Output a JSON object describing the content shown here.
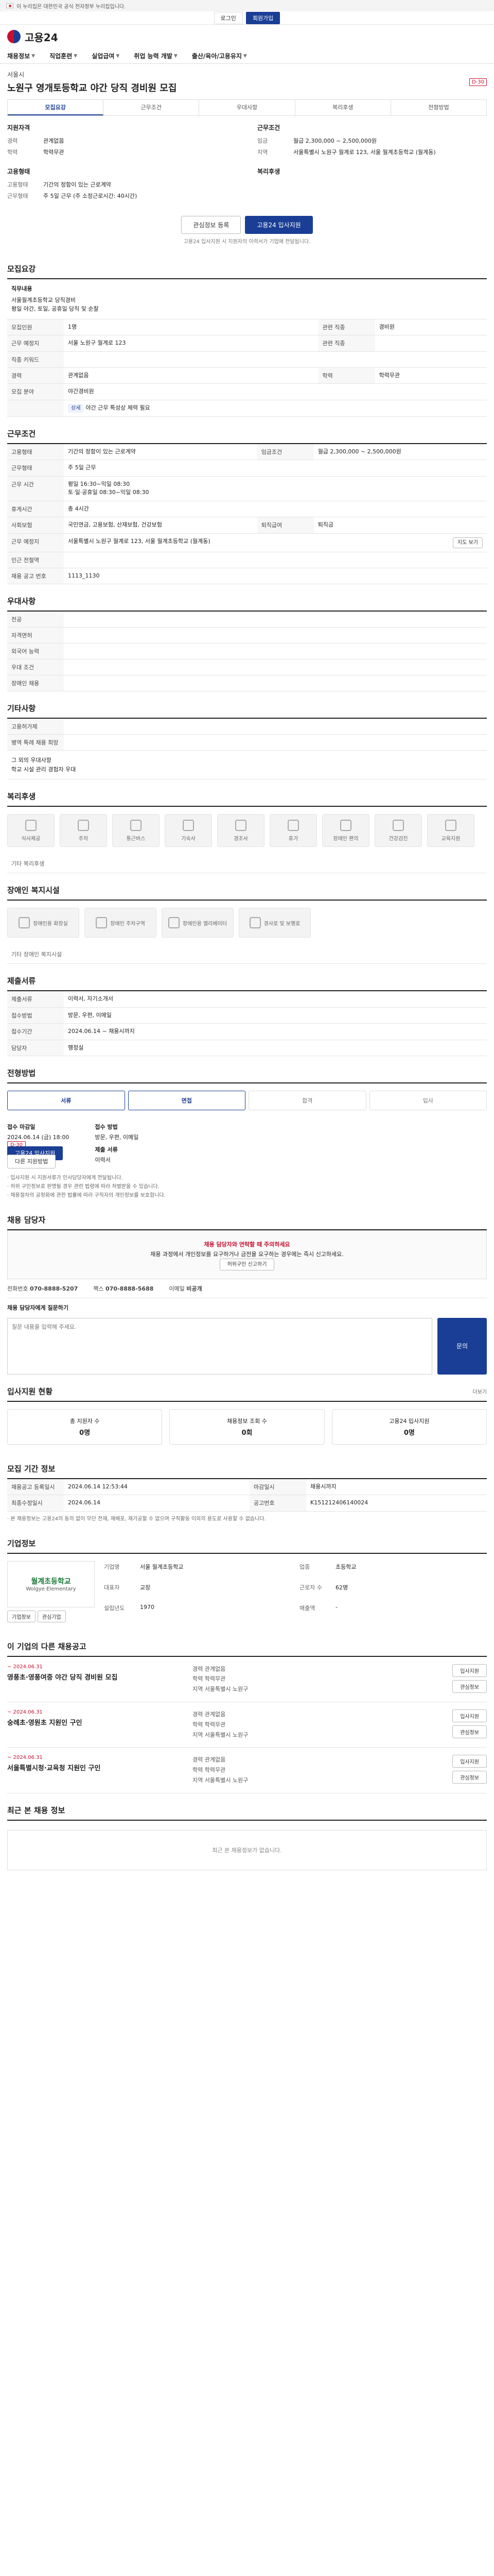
{
  "banner": {
    "text": "이 누리집은 대한민국 공식 전자정부 누리집입니다."
  },
  "login": {
    "login_label": "로그인",
    "join_label": "회원가입"
  },
  "brand": {
    "name": "고용24"
  },
  "gnb": [
    "채용정보",
    "직업훈련",
    "실업급여",
    "취업 능력 개발",
    "출산/육아/고용유지"
  ],
  "job": {
    "company": "서울시",
    "title": "노원구 영개토등학교 야간 당직 경비원 모집",
    "dday": "D-30",
    "tabs": [
      "모집요강",
      "근무조건",
      "우대사항",
      "복리후생",
      "전형방법"
    ]
  },
  "summary": {
    "left_head": "지원자격",
    "left": [
      {
        "k": "경력",
        "v": "관계없음"
      },
      {
        "k": "학력",
        "v": "학력무관"
      }
    ],
    "right_head": "근무조건",
    "right": [
      {
        "k": "임금",
        "v": "월급 2,300,000 ~ 2,500,000원"
      },
      {
        "k": "지역",
        "v": "서울특별시 노원구 월계로 123, 서울 월계초등학교 (월계동)"
      }
    ],
    "left2_head": "고용형태",
    "left2": [
      {
        "k": "고용형태",
        "v": "기간의 정함이 있는 근로계약"
      },
      {
        "k": "근무형태",
        "v": "주 5일 근무 (주 소정근로시간: 40시간)"
      }
    ],
    "right2_head": "복리후생",
    "right2": []
  },
  "actions": {
    "scrap": "관심정보 등록",
    "apply": "고용24 입사지원"
  },
  "notice": "고용24 입사지원 시 지원자의 이력서가 기업에 전달됩니다.",
  "recruit": {
    "title": "모집요강",
    "job_title_label": "직무내용",
    "job_desc": "서울월계초등학교 당직경비\n평일 야간, 토일, 공휴일 당직 및 순찰",
    "rows": [
      {
        "k": "모집인원",
        "v": "1명",
        "k2": "관련 직종",
        "v2": "경비원"
      },
      {
        "k": "근무 예정지",
        "v": "서울 노원구 월계로 123",
        "k2": "관련 직종",
        "v2": ""
      },
      {
        "k": "직종 키워드",
        "v": "",
        "k2": "",
        "v2": ""
      },
      {
        "k": "경력",
        "v": "관계없음",
        "k2": "학력",
        "v2": "학력무관"
      },
      {
        "k": "모집 분야",
        "v": "야간경비원",
        "k2": "",
        "v2": ""
      }
    ],
    "badge": "상세",
    "badge_note": "야간 근무 특성상 체력 필요"
  },
  "conditions": {
    "title": "근무조건",
    "rows": [
      {
        "k": "고용형태",
        "v": "기간의 정함이 있는 근로계약",
        "k2": "임금조건",
        "v2": "월급 2,300,000 ~ 2,500,000원"
      },
      {
        "k": "근무형태",
        "v": "주 5일 근무",
        "k2": "",
        "v2": ""
      },
      {
        "k": "근무 시간",
        "v": "평일 16:30~익일 08:30\n토·일·공휴일 08:30~익일 08:30",
        "k2": "",
        "v2": ""
      },
      {
        "k": "휴게시간",
        "v": "총 4시간",
        "k2": "",
        "v2": ""
      },
      {
        "k": "사회보험",
        "v": "국민연금, 고용보험, 산재보험, 건강보험",
        "k2": "퇴직급여",
        "v2": "퇴직금"
      },
      {
        "k": "근무 예정지",
        "v": "서울특별시 노원구 월계로 123, 서울 월계초등학교 (월계동)",
        "k2": "",
        "v2": ""
      },
      {
        "k": "인근 전철역",
        "v": "",
        "k2": "",
        "v2": ""
      },
      {
        "k": "채용 공고 번호",
        "v": "1113_1130",
        "k2": "",
        "v2": ""
      }
    ],
    "map_label": "지도 보기"
  },
  "preferences": {
    "title": "우대사항",
    "rows": [
      "전공",
      "자격면허",
      "외국어 능력",
      "우대 조건",
      "장애인 채용"
    ]
  },
  "etc": {
    "title": "기타사항",
    "rows": [
      "고용허가제",
      "병역 특례 채용 희망"
    ],
    "text": "그 외의 우대사항\n학교 시설 관리 경험자 우대"
  },
  "welfare": {
    "title": "복리후생",
    "items": [
      "식사제공",
      "주차",
      "통근버스",
      "기숙사",
      "경조사",
      "휴가",
      "장애인 편의",
      "건강검진",
      "교육지원"
    ],
    "empty": "기타 복리후생"
  },
  "disabled": {
    "title": "장애인 복지시설",
    "items": [
      "장애인용 화장실",
      "장애인 주차구역",
      "장애인용 엘리베이터",
      "경사로 및 보행로"
    ],
    "empty": "기타 장애인 복지시설"
  },
  "docs": {
    "title": "제출서류",
    "rows": [
      {
        "k": "제출서류",
        "v": "이력서, 자기소개서"
      },
      {
        "k": "접수방법",
        "v": "방문, 우편, 이메일"
      },
      {
        "k": "접수기간",
        "v": "2024.06.14 ~ 채용시까지"
      },
      {
        "k": "담당자",
        "v": "행정실"
      }
    ]
  },
  "selection": {
    "title": "전형방법",
    "steps": [
      "서류",
      "면접",
      "합격",
      "입사"
    ],
    "apply_head": "접수 방법",
    "apply_date_head": "접수 마감일",
    "apply_date": "2024.06.14 (금) 18:00",
    "dday": "D-30",
    "apply_btn": "고용24 입사지원",
    "alt_btn": "다른 지원방법",
    "period_head": "접수 방법",
    "methods": "방문, 우편, 이메일",
    "person_head": "제출 서류",
    "person": "이력서",
    "notes": [
      "· 입사지원 시 지원서류가 인사담당자에게 전달됩니다.",
      "· 허위 구인정보로 판명될 경우 관련 법령에 따라 처벌받을 수 있습니다.",
      "· 채용절차의 공정화에 관한 법률에 따라 구직자의 개인정보를 보호합니다."
    ]
  },
  "report": {
    "title": "채용 담당자",
    "warn": "채용 담당자와 연락할 때 주의하세요",
    "text": "채용 과정에서 개인정보를 요구하거나 금전을 요구하는 경우에는 즉시 신고하세요.",
    "btn": "허위구인 신고하기",
    "contact": [
      {
        "k": "전화번호",
        "v": "070-8888-5207"
      },
      {
        "k": "팩스",
        "v": "070-8888-5688"
      },
      {
        "k": "이메일",
        "v": "비공개"
      }
    ],
    "form_label": "채용 담당자에게 질문하기",
    "placeholder": "질문 내용을 입력해 주세요.",
    "send": "문의"
  },
  "apply_status": {
    "title": "입사지원 현황",
    "more": "더보기",
    "cards": [
      {
        "label": "총 지원자 수",
        "value": "0명"
      },
      {
        "label": "채용정보 조회 수",
        "value": "0회"
      },
      {
        "label": "고용24 입사지원",
        "value": "0명"
      }
    ]
  },
  "period": {
    "title": "모집 기간 정보",
    "rows": [
      {
        "k": "채용공고 등록일시",
        "v": "2024.06.14 12:53:44",
        "k2": "마감일시",
        "v2": "채용시까지"
      },
      {
        "k": "최종수정일시",
        "v": "2024.06.14",
        "k2": "공고번호",
        "v2": "K151212406140024"
      }
    ],
    "note": "· 본 채용정보는 고용24의 동의 없이 무단 전재, 재배포, 재가공할 수 없으며 구직활동 이외의 용도로 사용할 수 없습니다."
  },
  "company_info": {
    "title": "기업정보",
    "logo_main": "월계초등학교",
    "logo_sub": "Wolgye Elementary",
    "rows": [
      {
        "k": "기업명",
        "v": "서울 월계초등학교"
      },
      {
        "k": "업종",
        "v": "초등학교"
      },
      {
        "k": "대표자",
        "v": "교장"
      },
      {
        "k": "근로자 수",
        "v": "62명"
      },
      {
        "k": "설립년도",
        "v": "1970"
      },
      {
        "k": "매출액",
        "v": "-"
      }
    ],
    "btn1": "기업정보",
    "btn2": "관심기업"
  },
  "others": {
    "title": "이 기업의 다른 채용공고",
    "items": [
      {
        "date": "~ 2024.06.31",
        "title": "영풍초·영풍여중 야간 당직 경비원 모집",
        "lines": [
          "경력 관계없음",
          "학력 학력무관",
          "지역 서울특별시 노원구"
        ]
      },
      {
        "date": "~ 2024.06.31",
        "title": "숭례초·영원초 지원인 구인",
        "lines": [
          "경력 관계없음",
          "학력 학력무관",
          "지역 서울특별시 노원구"
        ]
      },
      {
        "date": "~ 2024.06.31",
        "title": "서울특별시청·교육청 지원인 구인",
        "lines": [
          "경력 관계없음",
          "학력 학력무관",
          "지역 서울특별시 노원구"
        ]
      }
    ],
    "btn_apply": "입사지원",
    "btn_scrap": "관심정보"
  },
  "recent": {
    "title": "최근 본 채용 정보",
    "empty": "최근 본 채용정보가 없습니다."
  }
}
